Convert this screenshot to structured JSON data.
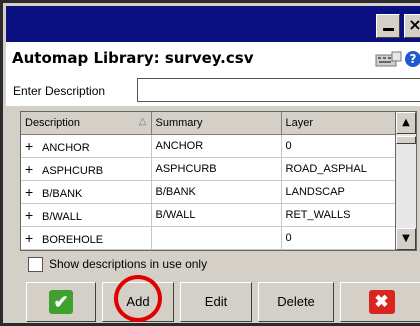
{
  "window": {
    "minimize_icon": "minimize-icon",
    "close_label": "×"
  },
  "header": {
    "title": "Automap Library: survey.csv",
    "icons": [
      "keyboard-icon",
      "help-icon"
    ],
    "help_label": "?"
  },
  "description_field": {
    "label": "Enter Description",
    "value": ""
  },
  "table": {
    "columns": [
      "Description",
      "Summary",
      "Layer"
    ],
    "sort_indicator": "△",
    "rows": [
      {
        "expand": "+",
        "description": "ANCHOR",
        "summary": "ANCHOR",
        "layer": "0"
      },
      {
        "expand": "+",
        "description": "ASPHCURB",
        "summary": "ASPHCURB",
        "layer": "ROAD_ASPHAL"
      },
      {
        "expand": "+",
        "description": "B/BANK",
        "summary": "B/BANK",
        "layer": "LANDSCAP"
      },
      {
        "expand": "+",
        "description": "B/WALL",
        "summary": "B/WALL",
        "layer": "RET_WALLS"
      },
      {
        "expand": "+",
        "description": "BOREHOLE",
        "summary": "",
        "layer": "0"
      }
    ]
  },
  "scrollbar": {
    "up_label": "▲",
    "down_label": "▼"
  },
  "options": {
    "show_in_use_label": "Show descriptions in use only",
    "show_in_use_checked": false
  },
  "buttons": {
    "ok_label": "✔",
    "add_label": "Add",
    "edit_label": "Edit",
    "delete_label": "Delete",
    "cancel_label": "✖"
  },
  "annotation": {
    "highlight_color": "#e00000"
  }
}
